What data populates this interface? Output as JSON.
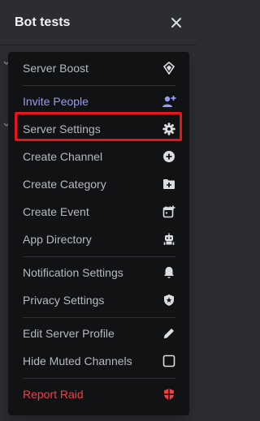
{
  "header": {
    "title": "Bot tests"
  },
  "colors": {
    "background": "#2b2d31",
    "menu": "#111214",
    "accent": "#949cf7",
    "danger": "#f23f43",
    "highlight": "#e8131b"
  },
  "menu": {
    "items": [
      {
        "label": "Server Boost",
        "icon": "boost-gem-icon"
      },
      {
        "label": "Invite People",
        "icon": "add-person-icon"
      },
      {
        "label": "Server Settings",
        "icon": "gear-icon"
      },
      {
        "label": "Create Channel",
        "icon": "plus-circle-icon"
      },
      {
        "label": "Create Category",
        "icon": "folder-plus-icon"
      },
      {
        "label": "Create Event",
        "icon": "calendar-plus-icon"
      },
      {
        "label": "App Directory",
        "icon": "robot-icon"
      },
      {
        "label": "Notification Settings",
        "icon": "bell-icon"
      },
      {
        "label": "Privacy Settings",
        "icon": "shield-star-icon"
      },
      {
        "label": "Edit Server Profile",
        "icon": "pencil-icon"
      },
      {
        "label": "Hide Muted Channels",
        "icon": "checkbox-icon"
      },
      {
        "label": "Report Raid",
        "icon": "shield-alert-icon"
      }
    ]
  }
}
